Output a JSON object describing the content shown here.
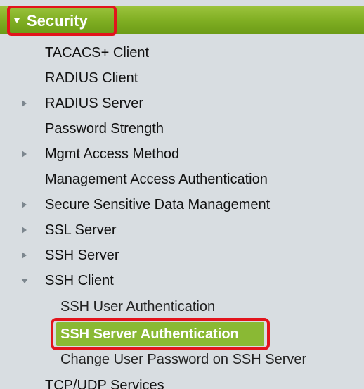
{
  "menu": {
    "section": "Security",
    "items": [
      "TACACS+ Client",
      "RADIUS Client",
      "RADIUS Server",
      "Password Strength",
      "Mgmt Access Method",
      "Management Access Authentication",
      "Secure Sensitive Data Management",
      "SSL Server",
      "SSH Server",
      "SSH Client"
    ],
    "ssh_client_children": [
      "SSH User Authentication",
      "SSH Server Authentication",
      "Change User Password on SSH Server"
    ],
    "after": "TCP/UDP Services",
    "selected": "SSH Server Authentication"
  },
  "colors": {
    "header_green": "#7fae22",
    "highlight_red": "#e2141c",
    "selected_green": "#8ab934",
    "background": "#d8dde1"
  }
}
